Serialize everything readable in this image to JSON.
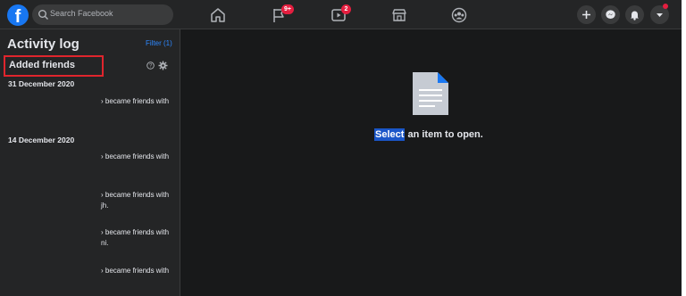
{
  "header": {
    "search_placeholder": "Search Facebook",
    "nav": {
      "groups_badge": "9+",
      "watch_badge": "2"
    }
  },
  "sidebar": {
    "title": "Activity log",
    "filter_label": "Filter (1)",
    "section_title": "Added friends",
    "groups": [
      {
        "date": "31 December 2020",
        "entries": [
          {
            "text": "became friends with",
            "suffix": ""
          }
        ]
      },
      {
        "date": "14 December 2020",
        "entries": [
          {
            "text": "became friends with",
            "suffix": ""
          },
          {
            "text": "became friends with",
            "suffix": "jh."
          },
          {
            "text": "became friends with",
            "suffix": "ni."
          },
          {
            "text": "became friends with",
            "suffix": ""
          }
        ]
      }
    ]
  },
  "main": {
    "selected_word": "Select",
    "rest_text": " an item to open."
  },
  "colors": {
    "accent": "#1877f2",
    "badge": "#e41e3f",
    "highlight_border": "#e0252d",
    "selection": "#1a56c8"
  }
}
